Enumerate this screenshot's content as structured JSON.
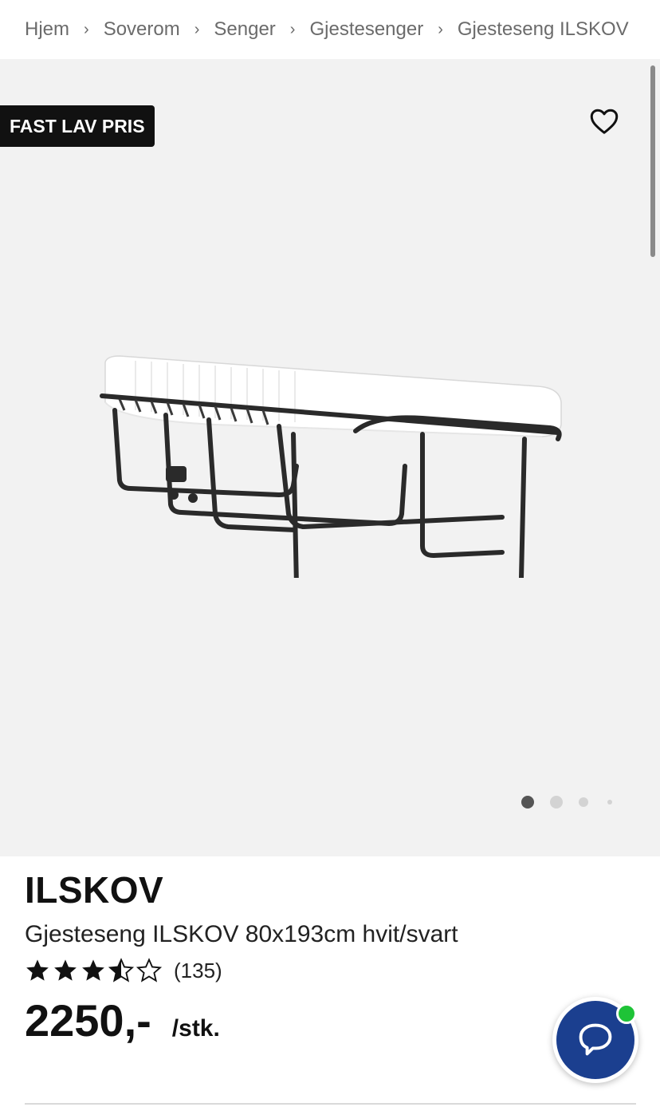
{
  "breadcrumb": {
    "items": [
      "Hjem",
      "Soverom",
      "Senger",
      "Gjestesenger",
      "Gjesteseng ILSKOV"
    ]
  },
  "gallery": {
    "badge": "FAST LAV PRIS",
    "favorite_icon": "heart-outline-icon",
    "image_count": 4,
    "active_index": 0
  },
  "product": {
    "brand": "ILSKOV",
    "description": "Gjesteseng ILSKOV 80x193cm hvit/svart",
    "rating": 3.5,
    "rating_max": 5,
    "review_count": "(135)",
    "price": "2250,-",
    "unit": "/stk."
  },
  "chat": {
    "icon": "chat-bubble-icon",
    "status": "online"
  },
  "colors": {
    "accent_blue": "#1b3f8f",
    "online_green": "#1ec337",
    "badge_bg": "#111111",
    "gallery_bg": "#f2f2f2"
  }
}
